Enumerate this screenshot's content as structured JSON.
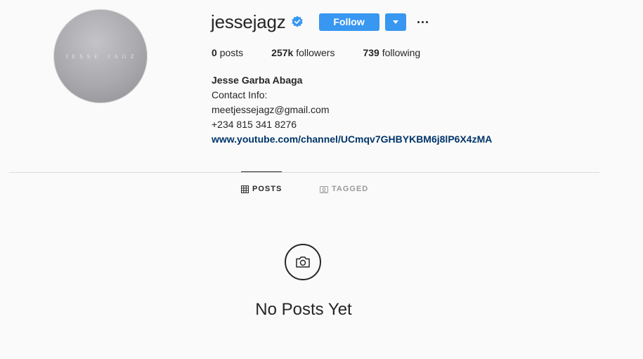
{
  "profile": {
    "username": "jessejagz",
    "avatar_text": "JESSE JAGZ",
    "follow_label": "Follow",
    "stats": {
      "posts_count": "0",
      "posts_label": "posts",
      "followers_count": "257k",
      "followers_label": "followers",
      "following_count": "739",
      "following_label": "following"
    },
    "bio": {
      "full_name": "Jesse Garba Abaga",
      "line1": "Contact Info:",
      "line2": "meetjessejagz@gmail.com",
      "line3": "+234 815 341 8276",
      "link": "www.youtube.com/channel/UCmqv7GHBYKBM6j8lP6X4zMA"
    }
  },
  "tabs": {
    "posts_label": "POSTS",
    "tagged_label": "TAGGED"
  },
  "empty_state": {
    "message": "No Posts Yet"
  },
  "colors": {
    "accent": "#3897f0",
    "link": "#003569",
    "background": "#fafafa"
  }
}
